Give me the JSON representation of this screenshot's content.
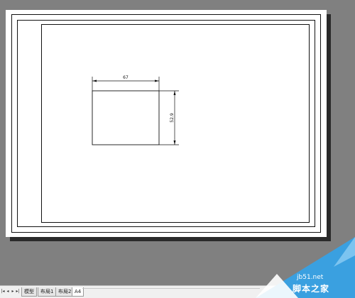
{
  "drawing": {
    "dim_width": "67",
    "dim_height": "52.9"
  },
  "layout_tabs": {
    "model": "模型",
    "layout1": "布局1",
    "layout2": "布局2",
    "a4": "A4"
  },
  "watermark": {
    "domain": "jb51.net",
    "name": "脚本之家"
  },
  "colors": {
    "workspace": "#808080",
    "paper": "#ffffff",
    "watermark_blue": "#3aa0e0"
  }
}
